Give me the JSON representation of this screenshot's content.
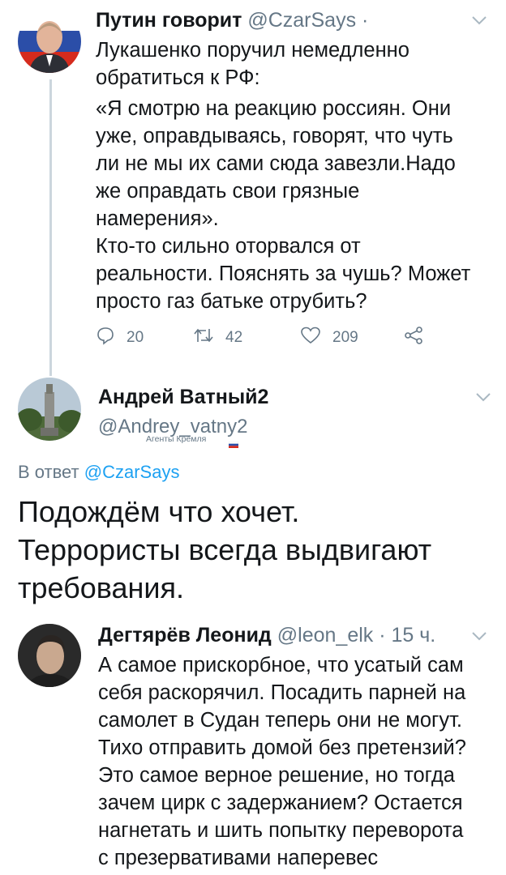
{
  "tweet1": {
    "name": "Путин говорит",
    "handle": "@CzarSays",
    "separator": "·",
    "lines": [
      "Лукашенко поручил немедленно",
      "обратиться к РФ:",
      "«Я смотрю на реакцию россиян. Они",
      "уже, оправдываясь, говорят, что чуть",
      "ли не мы их сами сюда завезли.Надо",
      "же оправдать свои грязные",
      "намерения».",
      "Кто-то сильно оторвался от",
      "реальности. Пояснять за чушь? Может",
      "просто газ батьке отрубить?"
    ],
    "replies": "20",
    "retweets": "42",
    "likes": "209"
  },
  "tweet2": {
    "name": "Андрей Ватный2",
    "handle": "@Andrey_vatny2",
    "badge": "Агенты Кремля",
    "reply_prefix": "В ответ",
    "reply_to": "@CzarSays",
    "lines": [
      "Подождём что хочет.",
      "Террористы всегда выдвигают",
      "требования."
    ]
  },
  "tweet3": {
    "name": "Дегтярёв Леонид",
    "handle": "@leon_elk",
    "time": "· 15 ч.",
    "lines": [
      "А самое прискорбное, что усатый сам",
      "себя раскорячил. Посадить парней на",
      "самолет в Судан теперь они не могут.",
      "Тихо отправить домой без претензий?",
      "Это самое верное решение, но тогда",
      "зачем цирк с задержанием? Остается",
      "нагнетать и шить попытку переворота",
      "с презервативами наперевес"
    ]
  },
  "colors": {
    "text": "#14171a",
    "secondary": "#657786",
    "link": "#1da1f2",
    "line": "#ccd6dd"
  },
  "icons": [
    "reply-icon",
    "retweet-icon",
    "like-icon",
    "share-icon",
    "chevron-down-icon"
  ]
}
